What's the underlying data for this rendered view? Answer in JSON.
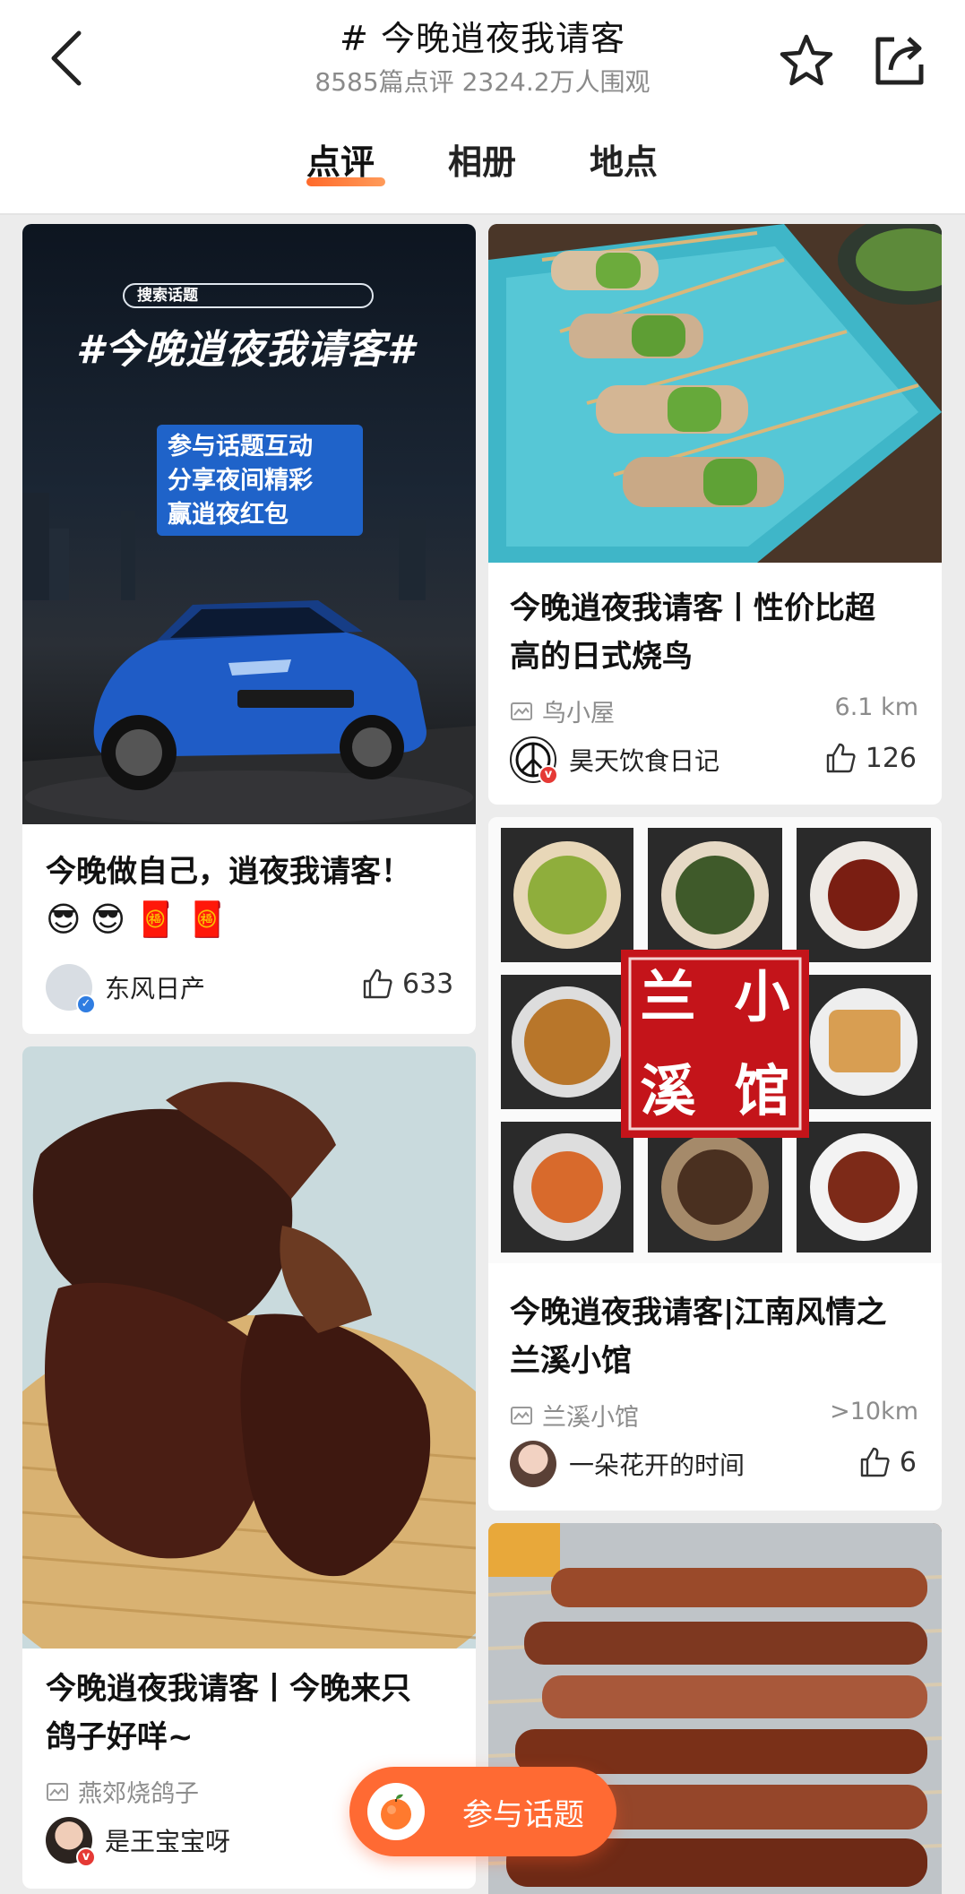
{
  "header": {
    "title": "# 今晚逍夜我请客",
    "subtitle": "8585篇点评 2324.2万人围观",
    "tabs": [
      {
        "label": "点评",
        "active": true
      },
      {
        "label": "相册",
        "active": false
      },
      {
        "label": "地点",
        "active": false
      }
    ],
    "icons": [
      "back-arrow-icon",
      "star-icon",
      "share-icon"
    ]
  },
  "feed": {
    "cards": [
      {
        "image_desc": "Nissan SUV promo poster",
        "poster": {
          "search_pill": "搜索话题",
          "headline": "#今晚逍夜我请客#",
          "lines": [
            "参与话题互动",
            "分享夜间精彩",
            "赢逍夜红包"
          ]
        },
        "title": "今晚做自己，逍夜我请客！",
        "emojis": [
          "😎",
          "😎",
          "🧧",
          "🧧"
        ],
        "author": "东风日产",
        "likes": "633"
      },
      {
        "image_desc": "Yakitori skewers on blue plate",
        "title_line1": "今晚逍夜我请客丨性价比超",
        "title_line2": "高的日式烧鸟",
        "place": "鸟小屋",
        "distance": "6.1 km",
        "author": "昊天饮食日记",
        "likes": "126"
      },
      {
        "image_desc": "Grid of dishes with restaurant seal",
        "seal_text": [
          "兰",
          "小",
          "溪",
          "馆"
        ],
        "title_line1": "今晚逍夜我请客|江南风情之",
        "title_line2": "兰溪小馆",
        "place": "兰溪小馆",
        "distance": ">10km",
        "author": "一朵花开的时间",
        "likes": "6"
      },
      {
        "image_desc": "Roast pigeon on bamboo tray",
        "title_line1": "今晚逍夜我请客丨今晚来只",
        "title_line2": "鸽子好咩~",
        "place": "燕郊烧鸽子",
        "author": "是王宝宝呀"
      },
      {
        "image_desc": "Grilled meat skewers"
      }
    ]
  },
  "fab": {
    "label": "参与话题"
  },
  "colors": {
    "accent": "#ff6a33",
    "verified_red": "#e53935",
    "verified_blue": "#2f7de1"
  }
}
